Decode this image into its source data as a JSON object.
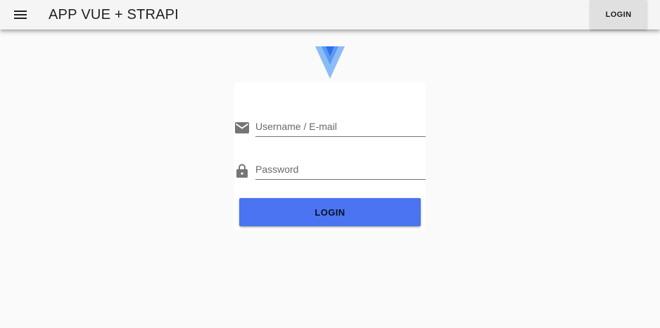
{
  "toolbar": {
    "menu_icon": "hamburger-menu-icon",
    "title_strong": "APP",
    "title_light": " VUE + STRAPI",
    "login_label": "LOGIN"
  },
  "logo": {
    "icon": "vue-logo-icon",
    "colors": {
      "outer": "#85b7f5",
      "inner": "#3b82f0"
    }
  },
  "login_form": {
    "username": {
      "icon": "email-icon",
      "placeholder": "Username / E-mail",
      "value": ""
    },
    "password": {
      "icon": "lock-icon",
      "placeholder": "Password",
      "value": ""
    },
    "submit_label": "LOGIN"
  },
  "colors": {
    "background": "#fafafa",
    "toolbar": "#f5f5f5",
    "primary_button": "#4a74f2",
    "icon_gray": "#757575"
  }
}
